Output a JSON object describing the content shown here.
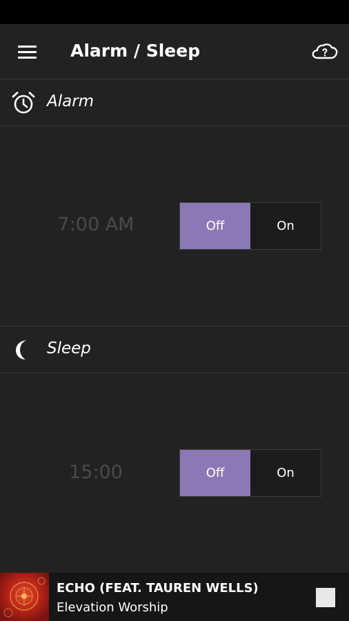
{
  "header": {
    "title": "Alarm / Sleep",
    "menu_icon": "hamburger-menu-icon",
    "cloud_icon": "cloud-question-icon"
  },
  "alarm": {
    "label": "Alarm",
    "icon": "alarm-clock-icon",
    "time": "7:00 AM",
    "toggle": {
      "off_label": "Off",
      "on_label": "On",
      "state": "Off"
    }
  },
  "sleep": {
    "label": "Sleep",
    "icon": "crescent-moon-icon",
    "time": "15:00",
    "toggle": {
      "off_label": "Off",
      "on_label": "On",
      "state": "Off"
    }
  },
  "now_playing": {
    "title": "ECHO (FEAT. TAUREN WELLS)",
    "artist": "Elevation Worship",
    "stop_icon": "stop-icon"
  },
  "colors": {
    "background": "#222222",
    "accent": "#8c78b4",
    "dim_text": "#4a4a4a",
    "status_bar": "#000000"
  }
}
